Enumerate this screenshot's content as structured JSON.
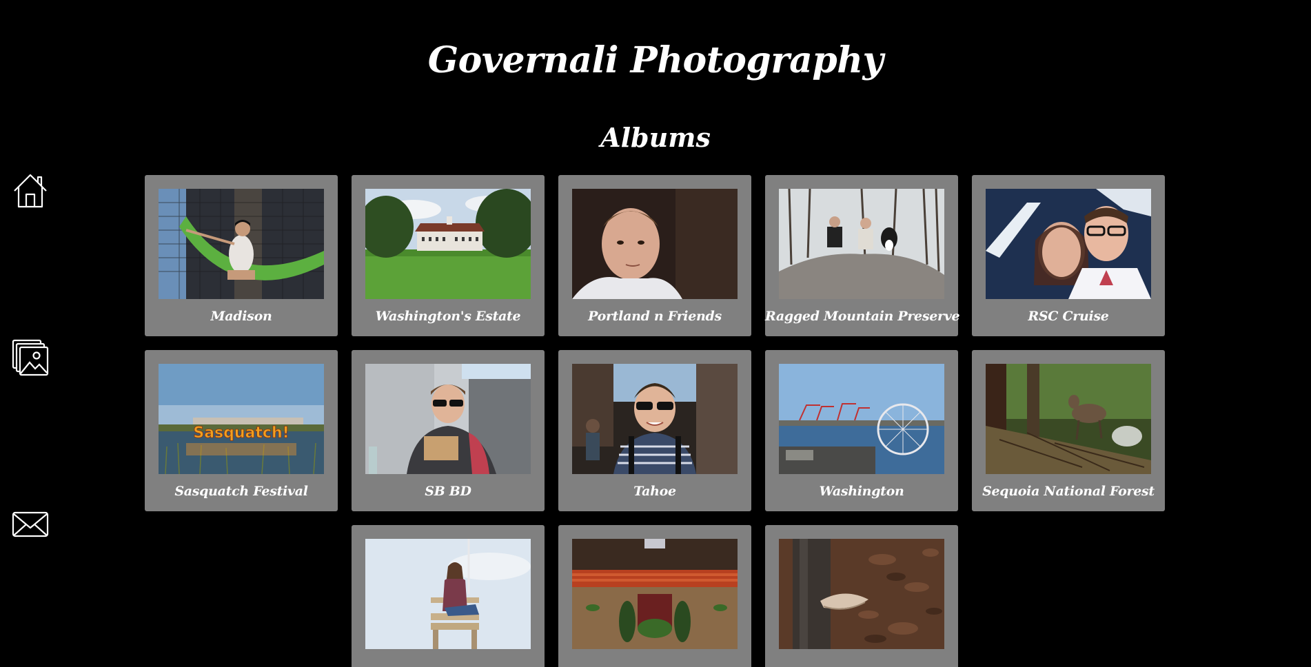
{
  "site": {
    "title": "Governali Photography"
  },
  "section": {
    "title": "Albums"
  },
  "nav": {
    "items": [
      {
        "name": "home",
        "icon": "home-icon"
      },
      {
        "name": "gallery",
        "icon": "gallery-icon"
      },
      {
        "name": "contact",
        "icon": "mail-icon"
      }
    ]
  },
  "albums": [
    {
      "label": "Madison"
    },
    {
      "label": "Washington's Estate"
    },
    {
      "label": "Portland n Friends"
    },
    {
      "label": "Ragged Mountain Preserve"
    },
    {
      "label": "RSC Cruise"
    },
    {
      "label": "Sasquatch Festival",
      "photo_text": "Sasquatch!"
    },
    {
      "label": "SB BD"
    },
    {
      "label": "Tahoe"
    },
    {
      "label": "Washington"
    },
    {
      "label": "Sequoia National Forest"
    },
    {
      "label": ""
    },
    {
      "label": ""
    },
    {
      "label": ""
    }
  ],
  "colors": {
    "background": "#000000",
    "card": "#808080",
    "text": "#ffffff"
  }
}
